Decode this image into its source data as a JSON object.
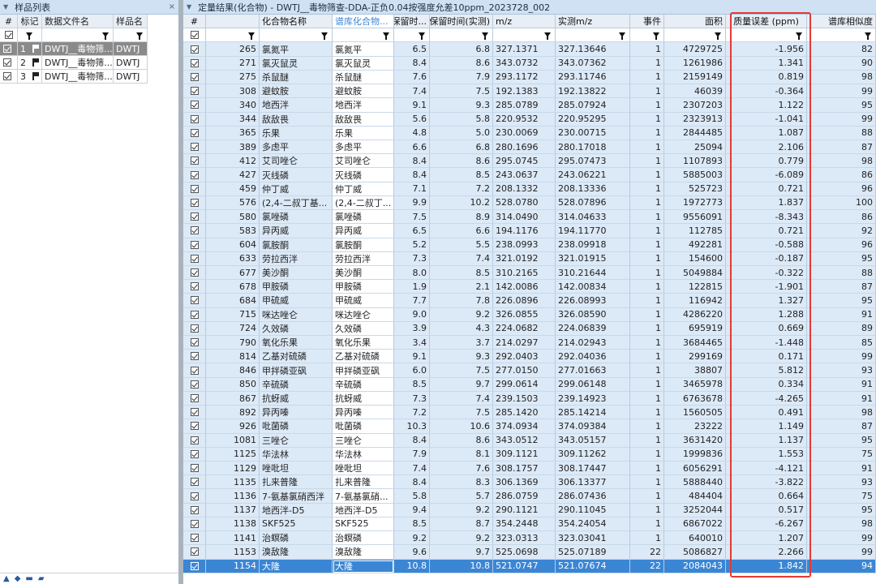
{
  "left_panel": {
    "title": "样品列表",
    "close_glyph": "×",
    "columns": [
      "#",
      "标记",
      "数据文件名",
      "样品名"
    ],
    "rows": [
      {
        "no": "1",
        "file": "DWTJ__毒物筛...",
        "sample": "DWTJ",
        "selected": true
      },
      {
        "no": "2",
        "file": "DWTJ__毒物筛...",
        "sample": "DWTJ",
        "selected": false
      },
      {
        "no": "3",
        "file": "DWTJ__毒物筛...",
        "sample": "DWTJ",
        "selected": false
      }
    ]
  },
  "right_panel": {
    "title": "定量结果(化合物) - DWTJ__毒物筛查-DDA-正负0.04按强度允差10ppm_2023728_002",
    "columns": {
      "id": "#",
      "name": "化合物名称",
      "lib": "谱库化合物...",
      "rt": "保留时...",
      "rta": "保留时间(实测)",
      "mz": "m/z",
      "amz": "实测m/z",
      "evt": "事件",
      "area": "面积",
      "err": "质量误差 (ppm)",
      "sim": "谱库相似度"
    },
    "rows": [
      {
        "id": "265",
        "name": "氯氮平",
        "lib": "氯氮平",
        "rt": "6.5",
        "rta": "6.8",
        "mz": "327.1371",
        "amz": "327.13646",
        "evt": "1",
        "area": "4729725",
        "err": "-1.956",
        "sim": "82"
      },
      {
        "id": "271",
        "name": "氯灭鼠灵",
        "lib": "氯灭鼠灵",
        "rt": "8.4",
        "rta": "8.6",
        "mz": "343.0732",
        "amz": "343.07362",
        "evt": "1",
        "area": "1261986",
        "err": "1.341",
        "sim": "90"
      },
      {
        "id": "275",
        "name": "杀鼠醚",
        "lib": "杀鼠醚",
        "rt": "7.6",
        "rta": "7.9",
        "mz": "293.1172",
        "amz": "293.11746",
        "evt": "1",
        "area": "2159149",
        "err": "0.819",
        "sim": "98"
      },
      {
        "id": "308",
        "name": "避蚊胺",
        "lib": "避蚊胺",
        "rt": "7.4",
        "rta": "7.5",
        "mz": "192.1383",
        "amz": "192.13822",
        "evt": "1",
        "area": "46039",
        "err": "-0.364",
        "sim": "99"
      },
      {
        "id": "340",
        "name": "地西泮",
        "lib": "地西泮",
        "rt": "9.1",
        "rta": "9.3",
        "mz": "285.0789",
        "amz": "285.07924",
        "evt": "1",
        "area": "2307203",
        "err": "1.122",
        "sim": "95"
      },
      {
        "id": "344",
        "name": "敌敌畏",
        "lib": "敌敌畏",
        "rt": "5.6",
        "rta": "5.8",
        "mz": "220.9532",
        "amz": "220.95295",
        "evt": "1",
        "area": "2323913",
        "err": "-1.041",
        "sim": "99"
      },
      {
        "id": "365",
        "name": "乐果",
        "lib": "乐果",
        "rt": "4.8",
        "rta": "5.0",
        "mz": "230.0069",
        "amz": "230.00715",
        "evt": "1",
        "area": "2844485",
        "err": "1.087",
        "sim": "88"
      },
      {
        "id": "389",
        "name": "多虑平",
        "lib": "多虑平",
        "rt": "6.6",
        "rta": "6.8",
        "mz": "280.1696",
        "amz": "280.17018",
        "evt": "1",
        "area": "25094",
        "err": "2.106",
        "sim": "87"
      },
      {
        "id": "412",
        "name": "艾司唑仑",
        "lib": "艾司唑仑",
        "rt": "8.4",
        "rta": "8.6",
        "mz": "295.0745",
        "amz": "295.07473",
        "evt": "1",
        "area": "1107893",
        "err": "0.779",
        "sim": "98"
      },
      {
        "id": "427",
        "name": "灭线磷",
        "lib": "灭线磷",
        "rt": "8.4",
        "rta": "8.5",
        "mz": "243.0637",
        "amz": "243.06221",
        "evt": "1",
        "area": "5885003",
        "err": "-6.089",
        "sim": "86"
      },
      {
        "id": "459",
        "name": "仲丁威",
        "lib": "仲丁威",
        "rt": "7.1",
        "rta": "7.2",
        "mz": "208.1332",
        "amz": "208.13336",
        "evt": "1",
        "area": "525723",
        "err": "0.721",
        "sim": "96"
      },
      {
        "id": "576",
        "name": "(2,4-二叔丁基...",
        "lib": "(2,4-二叔丁...",
        "rt": "9.9",
        "rta": "10.2",
        "mz": "528.0780",
        "amz": "528.07896",
        "evt": "1",
        "area": "1972773",
        "err": "1.837",
        "sim": "100"
      },
      {
        "id": "580",
        "name": "氯唑磷",
        "lib": "氯唑磷",
        "rt": "7.5",
        "rta": "8.9",
        "mz": "314.0490",
        "amz": "314.04633",
        "evt": "1",
        "area": "9556091",
        "err": "-8.343",
        "sim": "86"
      },
      {
        "id": "583",
        "name": "异丙威",
        "lib": "异丙威",
        "rt": "6.5",
        "rta": "6.6",
        "mz": "194.1176",
        "amz": "194.11770",
        "evt": "1",
        "area": "112785",
        "err": "0.721",
        "sim": "92"
      },
      {
        "id": "604",
        "name": "氯胺酮",
        "lib": "氯胺酮",
        "rt": "5.2",
        "rta": "5.5",
        "mz": "238.0993",
        "amz": "238.09918",
        "evt": "1",
        "area": "492281",
        "err": "-0.588",
        "sim": "96"
      },
      {
        "id": "633",
        "name": "劳拉西泮",
        "lib": "劳拉西泮",
        "rt": "7.3",
        "rta": "7.4",
        "mz": "321.0192",
        "amz": "321.01915",
        "evt": "1",
        "area": "154600",
        "err": "-0.187",
        "sim": "95"
      },
      {
        "id": "677",
        "name": "美沙酮",
        "lib": "美沙酮",
        "rt": "8.0",
        "rta": "8.5",
        "mz": "310.2165",
        "amz": "310.21644",
        "evt": "1",
        "area": "5049884",
        "err": "-0.322",
        "sim": "88"
      },
      {
        "id": "678",
        "name": "甲胺磷",
        "lib": "甲胺磷",
        "rt": "1.9",
        "rta": "2.1",
        "mz": "142.0086",
        "amz": "142.00834",
        "evt": "1",
        "area": "122815",
        "err": "-1.901",
        "sim": "87"
      },
      {
        "id": "684",
        "name": "甲硫威",
        "lib": "甲硫威",
        "rt": "7.7",
        "rta": "7.8",
        "mz": "226.0896",
        "amz": "226.08993",
        "evt": "1",
        "area": "116942",
        "err": "1.327",
        "sim": "95"
      },
      {
        "id": "715",
        "name": "咪达唑仑",
        "lib": "咪达唑仑",
        "rt": "9.0",
        "rta": "9.2",
        "mz": "326.0855",
        "amz": "326.08590",
        "evt": "1",
        "area": "4286220",
        "err": "1.288",
        "sim": "91"
      },
      {
        "id": "724",
        "name": "久效磷",
        "lib": "久效磷",
        "rt": "3.9",
        "rta": "4.3",
        "mz": "224.0682",
        "amz": "224.06839",
        "evt": "1",
        "area": "695919",
        "err": "0.669",
        "sim": "89"
      },
      {
        "id": "790",
        "name": "氧化乐果",
        "lib": "氧化乐果",
        "rt": "3.4",
        "rta": "3.7",
        "mz": "214.0297",
        "amz": "214.02943",
        "evt": "1",
        "area": "3684465",
        "err": "-1.448",
        "sim": "85"
      },
      {
        "id": "814",
        "name": "乙基对硫磷",
        "lib": "乙基对硫磷",
        "rt": "9.1",
        "rta": "9.3",
        "mz": "292.0403",
        "amz": "292.04036",
        "evt": "1",
        "area": "299169",
        "err": "0.171",
        "sim": "99"
      },
      {
        "id": "846",
        "name": "甲拌磷亚砜",
        "lib": "甲拌磷亚砜",
        "rt": "6.0",
        "rta": "7.5",
        "mz": "277.0150",
        "amz": "277.01663",
        "evt": "1",
        "area": "38807",
        "err": "5.812",
        "sim": "93"
      },
      {
        "id": "850",
        "name": "辛硫磷",
        "lib": "辛硫磷",
        "rt": "8.5",
        "rta": "9.7",
        "mz": "299.0614",
        "amz": "299.06148",
        "evt": "1",
        "area": "3465978",
        "err": "0.334",
        "sim": "91"
      },
      {
        "id": "867",
        "name": "抗蚜威",
        "lib": "抗蚜威",
        "rt": "7.3",
        "rta": "7.4",
        "mz": "239.1503",
        "amz": "239.14923",
        "evt": "1",
        "area": "6763678",
        "err": "-4.265",
        "sim": "91"
      },
      {
        "id": "892",
        "name": "异丙嗪",
        "lib": "异丙嗪",
        "rt": "7.2",
        "rta": "7.5",
        "mz": "285.1420",
        "amz": "285.14214",
        "evt": "1",
        "area": "1560505",
        "err": "0.491",
        "sim": "98"
      },
      {
        "id": "926",
        "name": "吡菌磷",
        "lib": "吡菌磷",
        "rt": "10.3",
        "rta": "10.6",
        "mz": "374.0934",
        "amz": "374.09384",
        "evt": "1",
        "area": "23222",
        "err": "1.149",
        "sim": "87"
      },
      {
        "id": "1081",
        "name": "三唑仑",
        "lib": "三唑仑",
        "rt": "8.4",
        "rta": "8.6",
        "mz": "343.0512",
        "amz": "343.05157",
        "evt": "1",
        "area": "3631420",
        "err": "1.137",
        "sim": "95"
      },
      {
        "id": "1125",
        "name": "华法林",
        "lib": "华法林",
        "rt": "7.9",
        "rta": "8.1",
        "mz": "309.1121",
        "amz": "309.11262",
        "evt": "1",
        "area": "1999836",
        "err": "1.553",
        "sim": "75"
      },
      {
        "id": "1129",
        "name": "唑吡坦",
        "lib": "唑吡坦",
        "rt": "7.4",
        "rta": "7.6",
        "mz": "308.1757",
        "amz": "308.17447",
        "evt": "1",
        "area": "6056291",
        "err": "-4.121",
        "sim": "91"
      },
      {
        "id": "1135",
        "name": "扎来普隆",
        "lib": "扎来普隆",
        "rt": "8.4",
        "rta": "8.3",
        "mz": "306.1369",
        "amz": "306.13377",
        "evt": "1",
        "area": "5888440",
        "err": "-3.822",
        "sim": "93"
      },
      {
        "id": "1136",
        "name": "7-氨基氯硝西泮",
        "lib": "7-氨基氯硝...",
        "rt": "5.8",
        "rta": "5.7",
        "mz": "286.0759",
        "amz": "286.07436",
        "evt": "1",
        "area": "484404",
        "err": "0.664",
        "sim": "75"
      },
      {
        "id": "1137",
        "name": "地西泮-D5",
        "lib": "地西泮-D5",
        "rt": "9.4",
        "rta": "9.2",
        "mz": "290.1121",
        "amz": "290.11045",
        "evt": "1",
        "area": "3252044",
        "err": "0.517",
        "sim": "95"
      },
      {
        "id": "1138",
        "name": "SKF525",
        "lib": "SKF525",
        "rt": "8.5",
        "rta": "8.7",
        "mz": "354.2448",
        "amz": "354.24054",
        "evt": "1",
        "area": "6867022",
        "err": "-6.267",
        "sim": "98"
      },
      {
        "id": "1141",
        "name": "治螟磷",
        "lib": "治螟磷",
        "rt": "9.2",
        "rta": "9.2",
        "mz": "323.0313",
        "amz": "323.03041",
        "evt": "1",
        "area": "640010",
        "err": "1.207",
        "sim": "99"
      },
      {
        "id": "1153",
        "name": "溴敌隆",
        "lib": "溴敌隆",
        "rt": "9.6",
        "rta": "9.7",
        "mz": "525.0698",
        "amz": "525.07189",
        "evt": "22",
        "area": "5086827",
        "err": "2.266",
        "sim": "99"
      },
      {
        "id": "1154",
        "name": "大隆",
        "lib": "大隆",
        "rt": "10.8",
        "rta": "10.8",
        "mz": "521.0747",
        "amz": "521.07674",
        "evt": "22",
        "area": "2084043",
        "err": "1.842",
        "sim": "94",
        "selected": true
      }
    ]
  },
  "colors": {
    "header_bg": "#e8eef5",
    "row_bg": "#dce9f7",
    "selected_bg": "#3b86d4",
    "highlight_border": "#e53935"
  }
}
